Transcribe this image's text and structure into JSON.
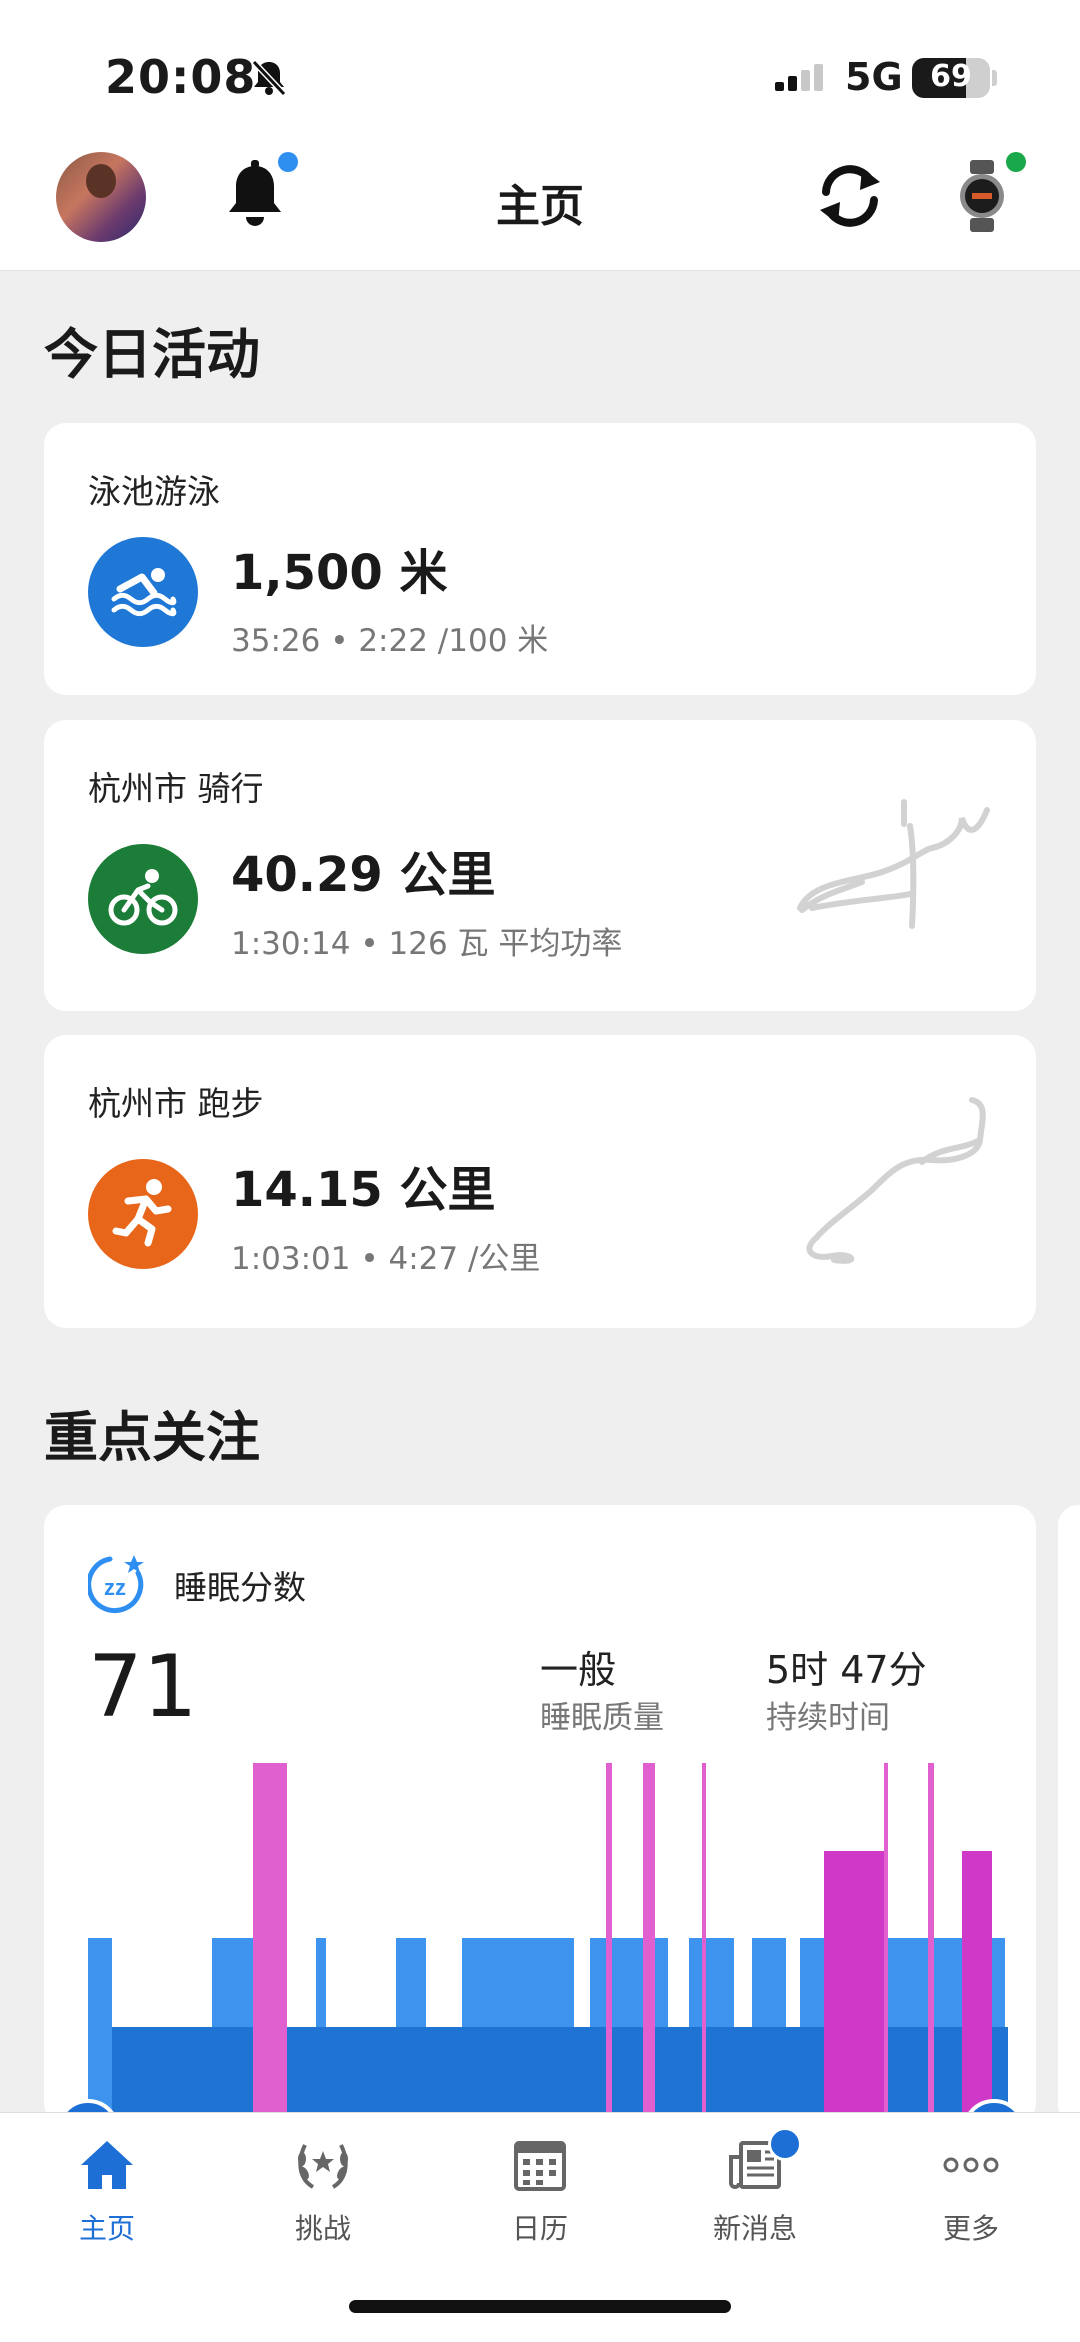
{
  "status_bar": {
    "time": "20:08",
    "network": "5G",
    "battery": "69",
    "battery_level": 0.69
  },
  "header": {
    "title": "主页"
  },
  "today": {
    "section_title": "今日活动",
    "activities": [
      {
        "title": "泳池游泳",
        "value": "1,500 米",
        "details": "35:26 • 2:22 /100 米",
        "icon": "swimmer-icon",
        "color": "#1f78d6"
      },
      {
        "title": "杭州市 骑行",
        "value": "40.29 公里",
        "details": "1:30:14 • 126 瓦 平均功率",
        "icon": "bike-icon",
        "color": "#1b7d37"
      },
      {
        "title": "杭州市 跑步",
        "value": "14.15 公里",
        "details": "1:03:01 • 4:27 /公里",
        "icon": "runner-icon",
        "color": "#e8661a"
      }
    ]
  },
  "focus": {
    "section_title": "重点关注",
    "sleep": {
      "title": "睡眠分数",
      "score": "71",
      "quality_value": "一般",
      "quality_label": "睡眠质量",
      "duration_value": "5时 47分",
      "duration_label": "持续时间"
    }
  },
  "tabs": [
    {
      "label": "主页",
      "icon": "home-icon",
      "active": true
    },
    {
      "label": "挑战",
      "icon": "laurel-icon",
      "active": false
    },
    {
      "label": "日历",
      "icon": "calendar-icon",
      "active": false
    },
    {
      "label": "新消息",
      "icon": "news-icon",
      "active": false
    },
    {
      "label": "更多",
      "icon": "more-icon",
      "active": false
    }
  ],
  "colors": {
    "accent": "#1d6fd6",
    "deep_sleep": "#1f74d3",
    "light_sleep": "#3d93ee",
    "rem_sleep": "#e060d0",
    "awake": "#d038c8"
  }
}
